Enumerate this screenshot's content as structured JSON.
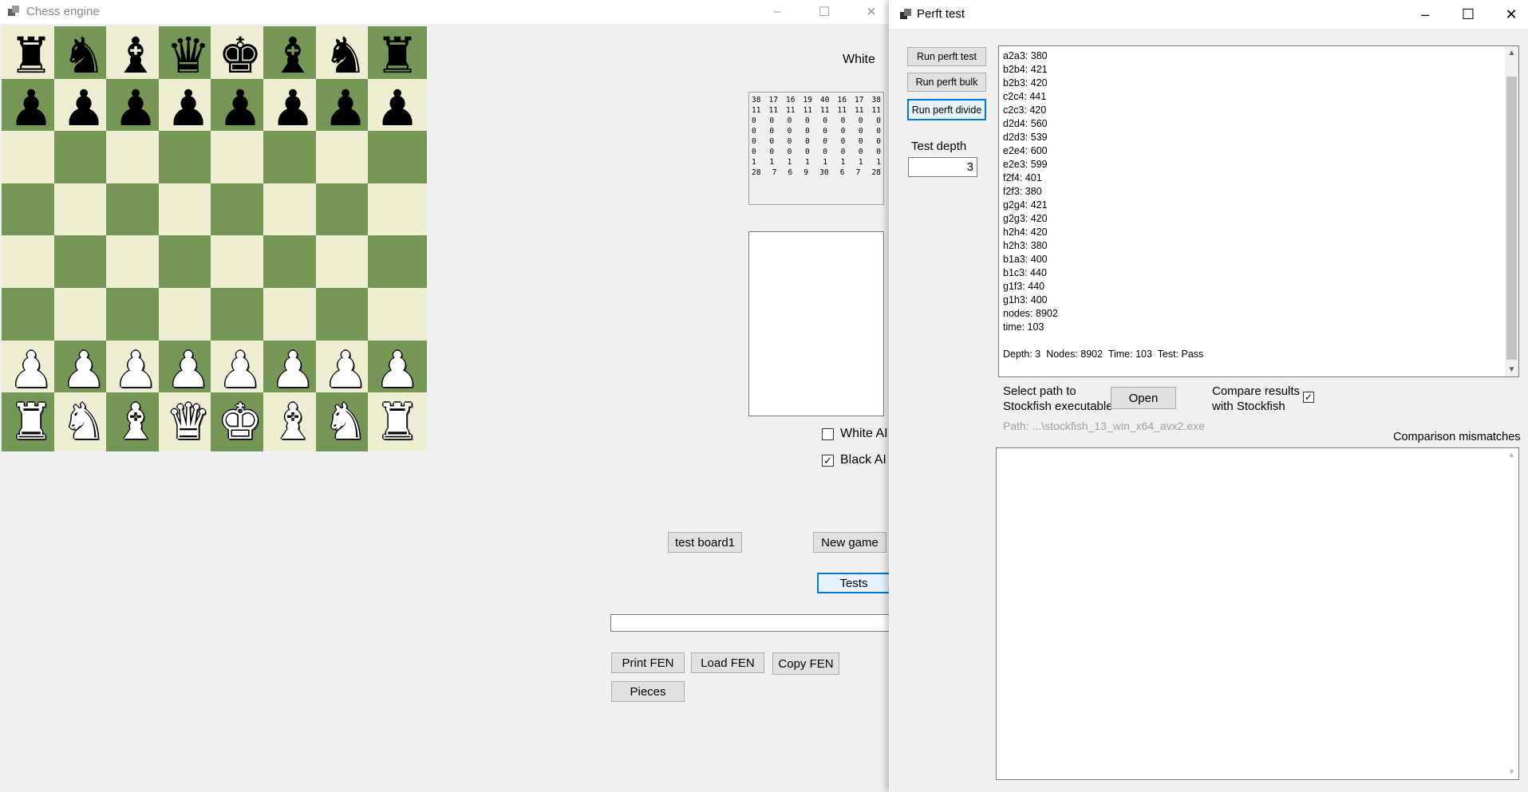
{
  "left_window": {
    "title": "Chess engine",
    "controls": [
      "–",
      "☐",
      "✕"
    ],
    "turn": "White",
    "board": [
      [
        "bR",
        "bN",
        "bB",
        "bQ",
        "bK",
        "bB",
        "bN",
        "bR"
      ],
      [
        "bP",
        "bP",
        "bP",
        "bP",
        "bP",
        "bP",
        "bP",
        "bP"
      ],
      [
        "",
        "",
        "",
        "",
        "",
        "",
        "",
        ""
      ],
      [
        "",
        "",
        "",
        "",
        "",
        "",
        "",
        ""
      ],
      [
        "",
        "",
        "",
        "",
        "",
        "",
        "",
        ""
      ],
      [
        "",
        "",
        "",
        "",
        "",
        "",
        "",
        ""
      ],
      [
        "wP",
        "wP",
        "wP",
        "wP",
        "wP",
        "wP",
        "wP",
        "wP"
      ],
      [
        "wR",
        "wN",
        "wB",
        "wQ",
        "wK",
        "wB",
        "wN",
        "wR"
      ]
    ],
    "matrix": [
      [
        "38",
        "17",
        "16",
        "19",
        "40",
        "16",
        "17",
        "38"
      ],
      [
        "11",
        "11",
        "11",
        "11",
        "11",
        "11",
        "11",
        "11"
      ],
      [
        "0",
        "0",
        "0",
        "0",
        "0",
        "0",
        "0",
        "0"
      ],
      [
        "0",
        "0",
        "0",
        "0",
        "0",
        "0",
        "0",
        "0"
      ],
      [
        "0",
        "0",
        "0",
        "0",
        "0",
        "0",
        "0",
        "0"
      ],
      [
        "0",
        "0",
        "0",
        "0",
        "0",
        "0",
        "0",
        "0"
      ],
      [
        "1",
        "1",
        "1",
        "1",
        "1",
        "1",
        "1",
        "1"
      ],
      [
        "28",
        "7",
        "6",
        "9",
        "30",
        "6",
        "7",
        "28"
      ]
    ],
    "white_ai": {
      "label": "White AI",
      "checked": false
    },
    "black_ai": {
      "label": "Black AI",
      "checked": true
    },
    "buttons": {
      "test_board": "test board1",
      "new_game": "New game",
      "tests": "Tests",
      "print_fen": "Print FEN",
      "load_fen": "Load FEN",
      "copy_fen": "Copy FEN",
      "pieces": "Pieces"
    },
    "fen_value": ""
  },
  "right_window": {
    "title": "Perft test",
    "controls": [
      "–",
      "☐",
      "✕"
    ],
    "buttons": {
      "run_perft_test": "Run perft test",
      "run_perft_bulk": "Run perft bulk",
      "run_perft_divide": "Run perft divide",
      "open": "Open"
    },
    "depth_label": "Test depth",
    "depth_value": "3",
    "output_lines": [
      "a2a3: 380",
      "b2b4: 421",
      "b2b3: 420",
      "c2c4: 441",
      "c2c3: 420",
      "d2d4: 560",
      "d2d3: 539",
      "e2e4: 600",
      "e2e3: 599",
      "f2f4: 401",
      "f2f3: 380",
      "g2g4: 421",
      "g2g3: 420",
      "h2h4: 420",
      "h2h3: 380",
      "b1a3: 400",
      "b1c3: 440",
      "g1f3: 440",
      "g1h3: 400",
      "nodes: 8902",
      "time: 103",
      "",
      "Depth: 3  Nodes: 8902  Time: 103  Test: Pass"
    ],
    "select_path_label_1": "Select path to",
    "select_path_label_2": "Stockfish executable",
    "compare_label_1": "Compare results",
    "compare_label_2": "with Stockfish",
    "compare_checked": true,
    "path_text": "Path: ...\\stockfish_13_win_x64_avx2.exe",
    "mismatch_label": "Comparison mismatches"
  },
  "colors": {
    "light_square": "#eeeed2",
    "dark_square": "#769656",
    "focus": "#0078d7"
  }
}
